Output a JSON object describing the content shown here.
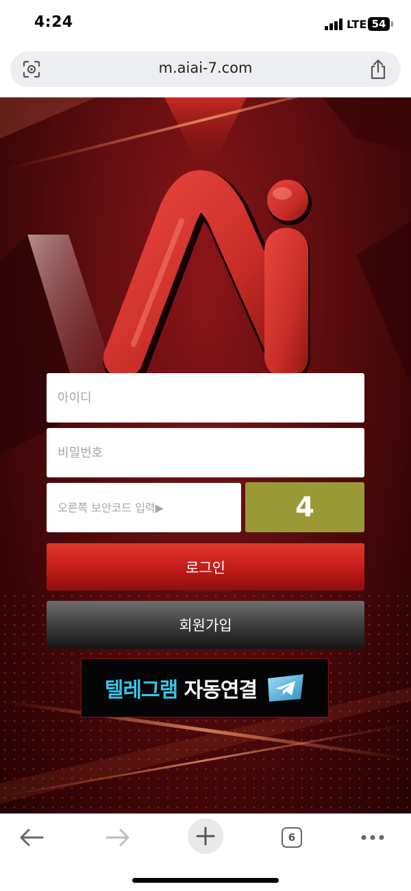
{
  "status_bar": {
    "time": "4:24",
    "network": "LTE",
    "battery": "54"
  },
  "browser": {
    "url": "m.aiai-7.com",
    "tab_count": "6",
    "icons": {
      "lens": "lens-icon",
      "share": "share-icon",
      "back": "back-arrow-icon",
      "forward": "forward-arrow-icon",
      "new_tab": "plus-icon",
      "tabs": "tabs-icon",
      "more": "more-icon"
    }
  },
  "login_form": {
    "id_placeholder": "아이디",
    "password_placeholder": "비밀번호",
    "captcha_placeholder": "오른쪽 보안코드 입력▶",
    "captcha_code": "4",
    "login_label": "로그인",
    "signup_label": "회원가입"
  },
  "telegram_banner": {
    "text_part1": "텔레그램",
    "text_part2": "자동연결"
  },
  "colors": {
    "background": "#5e0d10",
    "login_button": "#c21b19",
    "signup_button": "#3a3a3a",
    "captcha_box": "#999a35",
    "telegram_text": "#38c4ea",
    "logo": "#d0302c"
  }
}
